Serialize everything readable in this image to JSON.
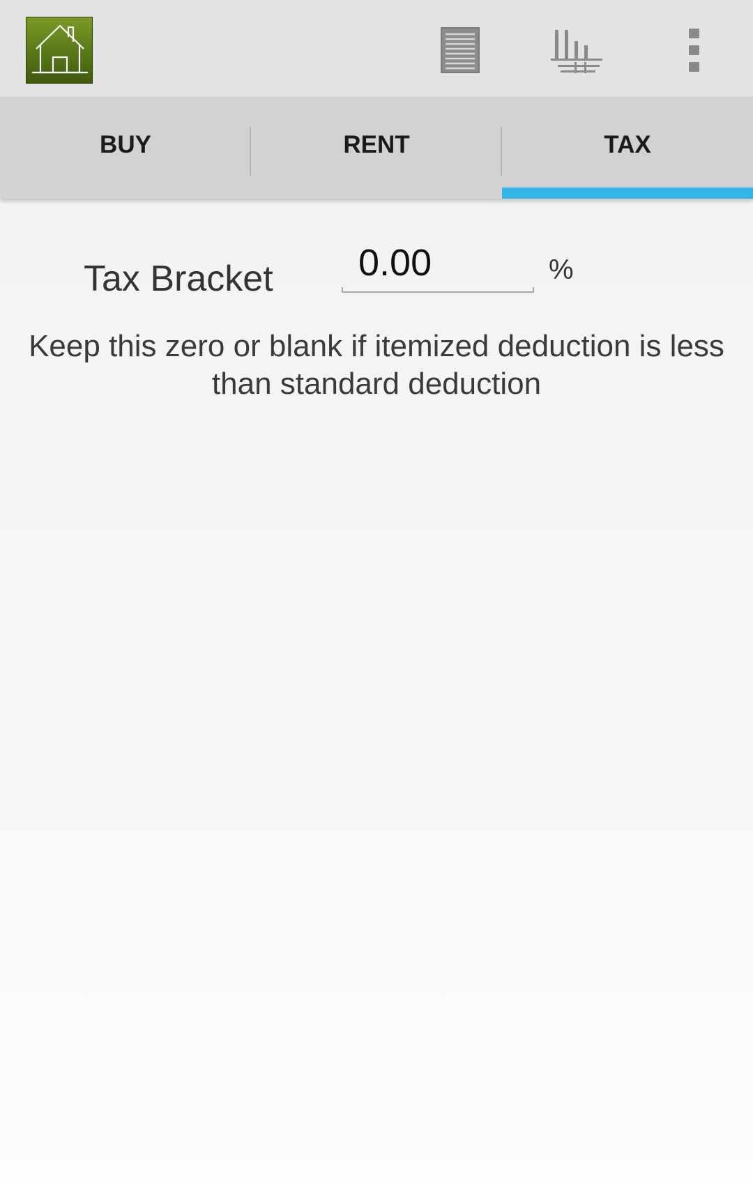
{
  "action_bar": {
    "icons": {
      "logo": "house-logo-icon",
      "list": "list-icon",
      "chart": "bar-chart-icon",
      "overflow": "overflow-menu-icon"
    }
  },
  "tabs": [
    {
      "label": "BUY",
      "selected": false
    },
    {
      "label": "RENT",
      "selected": false
    },
    {
      "label": "TAX",
      "selected": true
    }
  ],
  "tax_form": {
    "label": "Tax Bracket",
    "value": "0.00",
    "unit": "%",
    "hint": "Keep this zero or blank if itemized deduction is less than standard deduction"
  },
  "colors": {
    "tab_indicator": "#33b5e5",
    "logo_green": "#587718",
    "action_bar_bg": "#e3e3e3",
    "tab_bar_bg": "#d2d2d2"
  }
}
